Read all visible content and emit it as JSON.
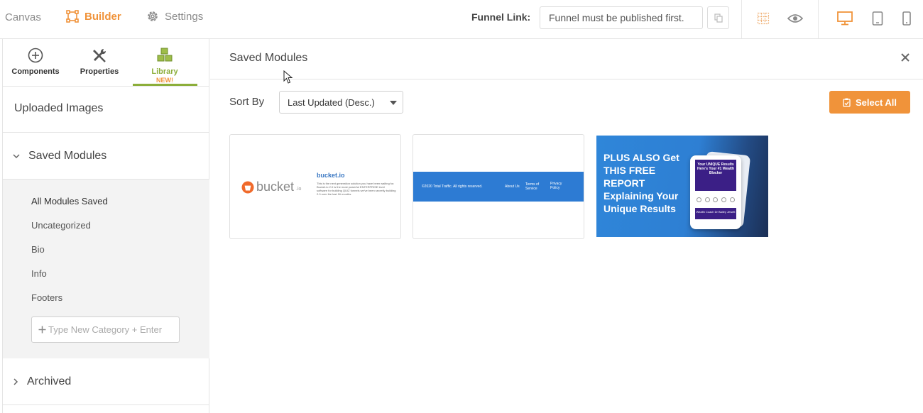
{
  "topbar": {
    "nav": {
      "canvas": "Canvas",
      "builder": "Builder",
      "settings": "Settings"
    },
    "funnel_link_label": "Funnel Link:",
    "funnel_link_value": "Funnel must be published first.",
    "accent_color": "#f0933a"
  },
  "sidebar": {
    "tabs": [
      {
        "label": "Components",
        "icon": "plus-circle-icon"
      },
      {
        "label": "Properties",
        "icon": "tools-icon"
      },
      {
        "label": "Library",
        "badge": "NEW!",
        "icon": "cubes-icon",
        "active": true
      }
    ],
    "sections": {
      "uploaded_images": "Uploaded Images",
      "saved_modules": "Saved Modules",
      "archived": "Archived"
    },
    "categories": [
      "All Modules Saved",
      "Uncategorized",
      "Bio",
      "Info",
      "Footers"
    ],
    "new_category_placeholder": "Type New Category + Enter"
  },
  "main": {
    "title": "Saved Modules",
    "sort_label": "Sort By",
    "sort_value": "Last Updated (Desc.)",
    "select_all": "Select All",
    "modules": [
      {
        "logo_text": "bucket",
        "logo_suffix": ".io",
        "side_title": "bucket.io",
        "side_text": "This is the next generation solution you have been waiting for. Bucket.io 2.0 is the most powerful ENTERPRISE level software for building QUIZ funnels we've been secretly building 2.0 over the last 16 months."
      },
      {
        "copyright": "©2020 Total Traffic. All rights reserved.",
        "links": [
          "About Us",
          "Terms of Service",
          "Privacy Policy"
        ]
      },
      {
        "headline": "PLUS ALSO Get THIS FREE REPORT Explaining Your Unique Results",
        "phone_title": "Your UNIQUE Results",
        "phone_subtitle": "Here's Your #1 Wealth Blocker",
        "phone_footer": "Wealth Coach Dr Bailey Jewett"
      }
    ]
  }
}
